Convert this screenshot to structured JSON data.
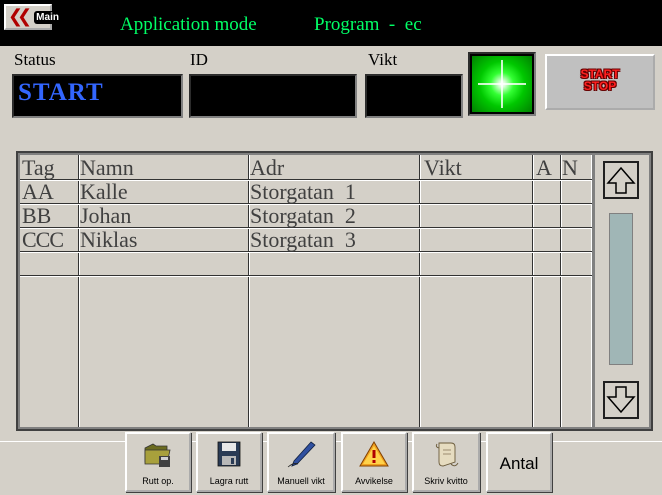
{
  "header": {
    "main_button_label": "Main",
    "mode_title": "Application mode",
    "program_title": "Program  -  ec"
  },
  "status": {
    "status_label": "Status",
    "status_value": "START",
    "id_label": "ID",
    "id_value": "",
    "vikt_label": "Vikt",
    "vikt_value": "",
    "start_label": "START",
    "stop_label": "STOP"
  },
  "table": {
    "columns": [
      "Tag",
      "Namn",
      "Adr",
      "Vikt",
      "A",
      "N"
    ],
    "rows": [
      [
        "AA",
        "Kalle",
        "Storgatan  1",
        "",
        "",
        ""
      ],
      [
        "BB",
        "Johan",
        "Storgatan  2",
        "",
        "",
        ""
      ],
      [
        "CCC",
        "Niklas",
        "Storgatan  3",
        "",
        "",
        ""
      ]
    ]
  },
  "toolbar": {
    "buttons": [
      {
        "label": "Rutt op.",
        "icon": "folder-icon"
      },
      {
        "label": "Lagra rutt",
        "icon": "floppy-disk-icon"
      },
      {
        "label": "Manuell vikt",
        "icon": "pen-icon"
      },
      {
        "label": "Avvikelse",
        "icon": "warning-icon"
      },
      {
        "label": "Skriv kvitto",
        "icon": "scroll-icon"
      },
      {
        "label": "Antal",
        "icon": ""
      }
    ]
  },
  "colors": {
    "header_bg": "#000000",
    "header_text": "#00ff66",
    "status_value": "#3366ff",
    "start_stop_text": "#ff2020",
    "lamp": "#00c800"
  }
}
